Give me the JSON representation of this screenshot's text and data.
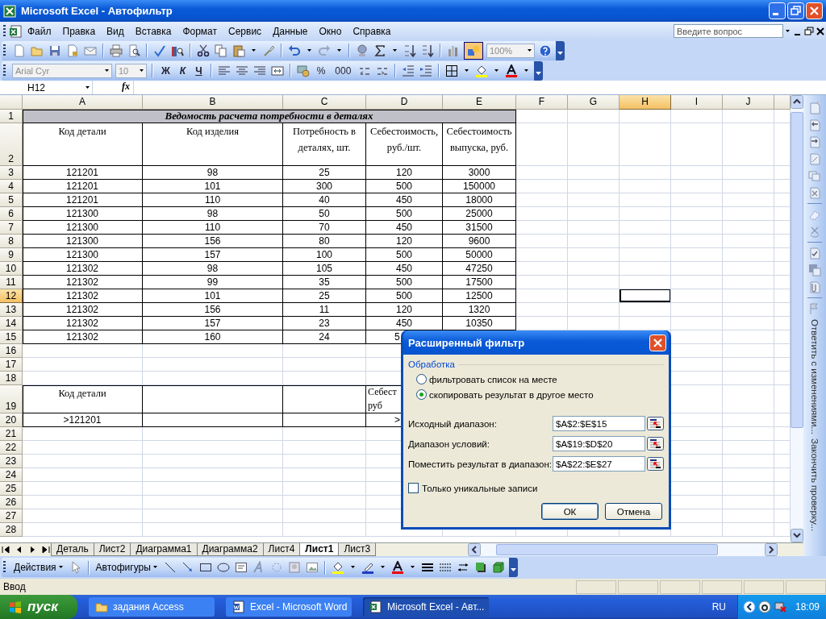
{
  "window": {
    "title": "Microsoft Excel - Автофильтр"
  },
  "menu": {
    "items": [
      "Файл",
      "Правка",
      "Вид",
      "Вставка",
      "Формат",
      "Сервис",
      "Данные",
      "Окно",
      "Справка"
    ],
    "help_search": {
      "placeholder": "Введите вопрос"
    }
  },
  "standard_toolbar": {
    "zoom": "100%"
  },
  "formatting_toolbar": {
    "font": "Arial Cyr",
    "size": "10",
    "bold": "Ж",
    "italic": "К",
    "underline": "Ч",
    "percent": "%",
    "thousands": "000"
  },
  "formula_bar": {
    "name_box": "H12",
    "function_label": "fx"
  },
  "sheet": {
    "columns": [
      {
        "letter": "A",
        "selected": false
      },
      {
        "letter": "B",
        "selected": false
      },
      {
        "letter": "C",
        "selected": false
      },
      {
        "letter": "D",
        "selected": false
      },
      {
        "letter": "E",
        "selected": false
      },
      {
        "letter": "F",
        "selected": false
      },
      {
        "letter": "G",
        "selected": false
      },
      {
        "letter": "H",
        "selected": true
      },
      {
        "letter": "I",
        "selected": false
      },
      {
        "letter": "J",
        "selected": false
      }
    ],
    "rows": [
      {
        "number": "1",
        "selected": false,
        "kind": "title",
        "cells": [
          {
            "text": "Ведомость расчета потребности в деталях",
            "colspan": 5
          }
        ]
      },
      {
        "number": "2",
        "selected": false,
        "kind": "header",
        "cells": [
          "Код  детали",
          "Код изделия",
          "Потребность в деталях, шт.",
          "Себестоимость, руб./шт.",
          "Себестоимость выпуска, руб."
        ]
      },
      {
        "number": "3",
        "selected": false,
        "kind": "data",
        "cells": [
          "121201",
          "98",
          "25",
          "120",
          "3000"
        ]
      },
      {
        "number": "4",
        "selected": false,
        "kind": "data",
        "cells": [
          "121201",
          "101",
          "300",
          "500",
          "150000"
        ]
      },
      {
        "number": "5",
        "selected": false,
        "kind": "data",
        "cells": [
          "121201",
          "110",
          "40",
          "450",
          "18000"
        ]
      },
      {
        "number": "6",
        "selected": false,
        "kind": "data",
        "cells": [
          "121300",
          "98",
          "50",
          "500",
          "25000"
        ]
      },
      {
        "number": "7",
        "selected": false,
        "kind": "data",
        "cells": [
          "121300",
          "110",
          "70",
          "450",
          "31500"
        ]
      },
      {
        "number": "8",
        "selected": false,
        "kind": "data",
        "cells": [
          "121300",
          "156",
          "80",
          "120",
          "9600"
        ]
      },
      {
        "number": "9",
        "selected": false,
        "kind": "data",
        "cells": [
          "121300",
          "157",
          "100",
          "500",
          "50000"
        ]
      },
      {
        "number": "10",
        "selected": false,
        "kind": "data",
        "cells": [
          "121302",
          "98",
          "105",
          "450",
          "47250"
        ]
      },
      {
        "number": "11",
        "selected": false,
        "kind": "data",
        "cells": [
          "121302",
          "99",
          "35",
          "500",
          "17500"
        ]
      },
      {
        "number": "12",
        "selected": true,
        "kind": "data",
        "cells": [
          "121302",
          "101",
          "25",
          "500",
          "12500"
        ]
      },
      {
        "number": "13",
        "selected": false,
        "kind": "data",
        "cells": [
          "121302",
          "156",
          "11",
          "120",
          "1320"
        ]
      },
      {
        "number": "14",
        "selected": false,
        "kind": "data",
        "cells": [
          "121302",
          "157",
          "23",
          "450",
          "10350"
        ]
      },
      {
        "number": "15",
        "selected": false,
        "kind": "data",
        "cells": [
          "121302",
          "160",
          "24",
          "5"
        ]
      },
      {
        "number": "16",
        "selected": false,
        "kind": "empty",
        "cells": []
      },
      {
        "number": "17",
        "selected": false,
        "kind": "empty",
        "cells": []
      },
      {
        "number": "18",
        "selected": false,
        "kind": "empty",
        "cells": []
      },
      {
        "number": "19",
        "selected": false,
        "kind": "header",
        "cells": [
          "Код детали",
          null,
          null,
          "Себест\nруб"
        ]
      },
      {
        "number": "20",
        "selected": false,
        "kind": "data",
        "cells": [
          ">121201",
          null,
          null,
          ">"
        ]
      },
      {
        "number": "21",
        "selected": false,
        "kind": "empty",
        "cells": []
      },
      {
        "number": "22",
        "selected": false,
        "kind": "empty",
        "cells": []
      },
      {
        "number": "23",
        "selected": false,
        "kind": "empty",
        "cells": []
      },
      {
        "number": "24",
        "selected": false,
        "kind": "empty",
        "cells": []
      },
      {
        "number": "25",
        "selected": false,
        "kind": "empty",
        "cells": []
      },
      {
        "number": "26",
        "selected": false,
        "kind": "empty",
        "cells": []
      },
      {
        "number": "27",
        "selected": false,
        "kind": "empty",
        "cells": []
      },
      {
        "number": "28",
        "selected": false,
        "kind": "empty",
        "cells": []
      }
    ]
  },
  "sheet_tabs": [
    {
      "label": "Деталь",
      "selected": false
    },
    {
      "label": "Лист2",
      "selected": false
    },
    {
      "label": "Диаграмма1",
      "selected": false
    },
    {
      "label": "Диаграмма2",
      "selected": false
    },
    {
      "label": "Лист4",
      "selected": false
    },
    {
      "label": "Лист1",
      "selected": true
    },
    {
      "label": "Лист3",
      "selected": false
    }
  ],
  "task_pane": {
    "links": [
      "Ответить с изменениями...",
      "Закончить проверку..."
    ]
  },
  "drawing_toolbar": {
    "actions": "Действия",
    "autoshapes": "Автофигуры"
  },
  "status_bar": {
    "mode": "Ввод"
  },
  "dialog": {
    "title": "Расширенный фильтр",
    "group": "Обработка",
    "options": [
      {
        "label": "фильтровать список на месте",
        "selected": false
      },
      {
        "label": "скопировать результат в другое место",
        "selected": true
      }
    ],
    "fields": [
      {
        "label": "Исходный диапазон:",
        "value": "$A$2:$E$15"
      },
      {
        "label": "Диапазон условий:",
        "value": "$A$19:$D$20"
      },
      {
        "label": "Поместить результат в диапазон:",
        "value": "$A$22:$E$27"
      }
    ],
    "unique_only": {
      "label": "Только уникальные записи",
      "checked": false
    },
    "buttons": [
      "ОК",
      "Отмена"
    ]
  },
  "taskbar": {
    "start": "пуск",
    "tasks": [
      {
        "kind": "folder",
        "label": "задания Access",
        "selected": false
      },
      {
        "kind": "word",
        "label": "Excel - Microsoft Word",
        "selected": false
      },
      {
        "kind": "excel",
        "label": "Microsoft Excel - Авт...",
        "selected": true
      }
    ],
    "language": "RU",
    "clock": "18:09"
  }
}
